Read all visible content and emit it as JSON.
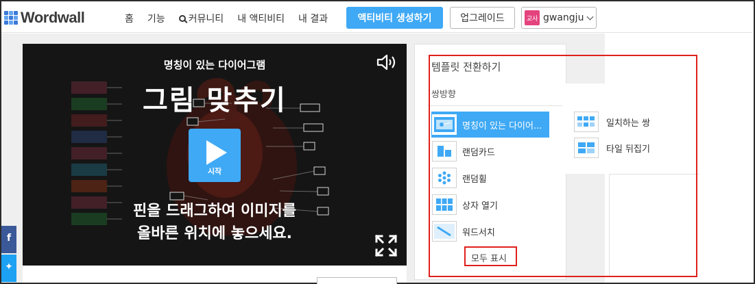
{
  "header": {
    "logo": "Wordwall",
    "nav": [
      {
        "label": "홈"
      },
      {
        "label": "기능"
      },
      {
        "label": "커뮤니티"
      },
      {
        "label": "내 액티비티"
      },
      {
        "label": "내 결과"
      }
    ],
    "create_button": "액티비티 생성하기",
    "upgrade_button": "업그레이드",
    "user": {
      "badge": "교사",
      "name": "gwangju"
    }
  },
  "player": {
    "subtitle": "명칭이 있는 다이어그램",
    "title": "그림 맞추기",
    "start_label": "시작",
    "instructions": [
      "핀을 드래그하여 이미지를",
      "올바른 위치에 놓으세요."
    ]
  },
  "template_panel": {
    "title": "템플릿 전환하기",
    "section": "쌍방향",
    "items": [
      {
        "label": "명칭이 있는 다이어...",
        "icon": "labelled-diagram-icon",
        "active": true
      },
      {
        "label": "랜덤카드",
        "icon": "random-cards-icon",
        "active": false
      },
      {
        "label": "랜덤휠",
        "icon": "random-wheel-icon",
        "active": false
      },
      {
        "label": "상자 열기",
        "icon": "open-box-icon",
        "active": false
      },
      {
        "label": "워드서치",
        "icon": "wordsearch-icon",
        "active": false
      }
    ],
    "show_all": "모두 표시"
  },
  "flyout": {
    "items": [
      {
        "label": "일치하는 쌍",
        "icon": "matching-pairs-icon"
      },
      {
        "label": "타일 뒤집기",
        "icon": "flip-tiles-icon"
      }
    ]
  },
  "colors": {
    "accent": "#3fa9f5",
    "annotation_red": "#e0201b",
    "player_bg": "#151515",
    "user_badge": "#e4447e"
  }
}
